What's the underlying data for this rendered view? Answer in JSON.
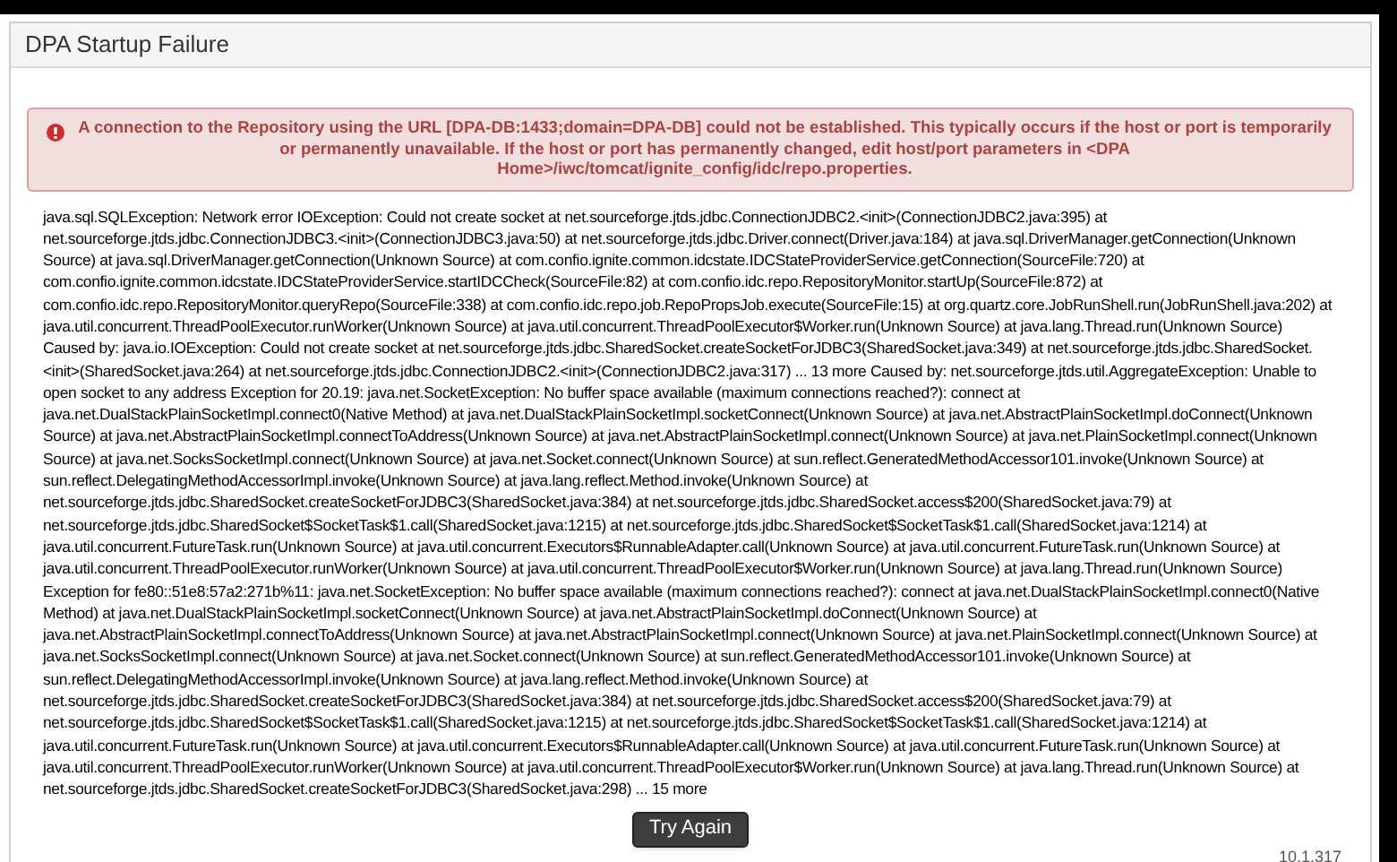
{
  "panel": {
    "title": "DPA Startup Failure"
  },
  "alert": {
    "message": "A connection to the Repository using the URL [DPA-DB:1433;domain=DPA-DB] could not be established. This typically occurs if the host or port is temporarily or permanently unavailable. If the host or port has permanently changed, edit host/port parameters in <DPA Home>/iwc/tomcat/ignite_config/idc/repo.properties."
  },
  "stack_trace": "java.sql.SQLException: Network error IOException: Could not create socket at net.sourceforge.jtds.jdbc.ConnectionJDBC2.<init>(ConnectionJDBC2.java:395) at net.sourceforge.jtds.jdbc.ConnectionJDBC3.<init>(ConnectionJDBC3.java:50) at net.sourceforge.jtds.jdbc.Driver.connect(Driver.java:184) at java.sql.DriverManager.getConnection(Unknown Source) at java.sql.DriverManager.getConnection(Unknown Source) at com.confio.ignite.common.idcstate.IDCStateProviderService.getConnection(SourceFile:720) at com.confio.ignite.common.idcstate.IDCStateProviderService.startIDCCheck(SourceFile:82) at com.confio.idc.repo.RepositoryMonitor.startUp(SourceFile:872) at com.confio.idc.repo.RepositoryMonitor.queryRepo(SourceFile:338) at com.confio.idc.repo.job.RepoPropsJob.execute(SourceFile:15) at org.quartz.core.JobRunShell.run(JobRunShell.java:202) at java.util.concurrent.ThreadPoolExecutor.runWorker(Unknown Source) at java.util.concurrent.ThreadPoolExecutor$Worker.run(Unknown Source) at java.lang.Thread.run(Unknown Source) Caused by: java.io.IOException: Could not create socket at net.sourceforge.jtds.jdbc.SharedSocket.createSocketForJDBC3(SharedSocket.java:349) at net.sourceforge.jtds.jdbc.SharedSocket.<init>(SharedSocket.java:264) at net.sourceforge.jtds.jdbc.ConnectionJDBC2.<init>(ConnectionJDBC2.java:317) ... 13 more Caused by: net.sourceforge.jtds.util.AggregateException: Unable to open socket to any address Exception for 20.19: java.net.SocketException: No buffer space available (maximum connections reached?): connect at java.net.DualStackPlainSocketImpl.connect0(Native Method) at java.net.DualStackPlainSocketImpl.socketConnect(Unknown Source) at java.net.AbstractPlainSocketImpl.doConnect(Unknown Source) at java.net.AbstractPlainSocketImpl.connectToAddress(Unknown Source) at java.net.AbstractPlainSocketImpl.connect(Unknown Source) at java.net.PlainSocketImpl.connect(Unknown Source) at java.net.SocksSocketImpl.connect(Unknown Source) at java.net.Socket.connect(Unknown Source) at sun.reflect.GeneratedMethodAccessor101.invoke(Unknown Source) at sun.reflect.DelegatingMethodAccessorImpl.invoke(Unknown Source) at java.lang.reflect.Method.invoke(Unknown Source) at net.sourceforge.jtds.jdbc.SharedSocket.createSocketForJDBC3(SharedSocket.java:384) at net.sourceforge.jtds.jdbc.SharedSocket.access$200(SharedSocket.java:79) at net.sourceforge.jtds.jdbc.SharedSocket$SocketTask$1.call(SharedSocket.java:1215) at net.sourceforge.jtds.jdbc.SharedSocket$SocketTask$1.call(SharedSocket.java:1214) at java.util.concurrent.FutureTask.run(Unknown Source) at java.util.concurrent.Executors$RunnableAdapter.call(Unknown Source) at java.util.concurrent.FutureTask.run(Unknown Source) at java.util.concurrent.ThreadPoolExecutor.runWorker(Unknown Source) at java.util.concurrent.ThreadPoolExecutor$Worker.run(Unknown Source) at java.lang.Thread.run(Unknown Source) Exception for fe80::51e8:57a2:271b%11: java.net.SocketException: No buffer space available (maximum connections reached?): connect at java.net.DualStackPlainSocketImpl.connect0(Native Method) at java.net.DualStackPlainSocketImpl.socketConnect(Unknown Source) at java.net.AbstractPlainSocketImpl.doConnect(Unknown Source) at java.net.AbstractPlainSocketImpl.connectToAddress(Unknown Source) at java.net.AbstractPlainSocketImpl.connect(Unknown Source) at java.net.PlainSocketImpl.connect(Unknown Source) at java.net.SocksSocketImpl.connect(Unknown Source) at java.net.Socket.connect(Unknown Source) at sun.reflect.GeneratedMethodAccessor101.invoke(Unknown Source) at sun.reflect.DelegatingMethodAccessorImpl.invoke(Unknown Source) at java.lang.reflect.Method.invoke(Unknown Source) at net.sourceforge.jtds.jdbc.SharedSocket.createSocketForJDBC3(SharedSocket.java:384) at net.sourceforge.jtds.jdbc.SharedSocket.access$200(SharedSocket.java:79) at net.sourceforge.jtds.jdbc.SharedSocket$SocketTask$1.call(SharedSocket.java:1215) at net.sourceforge.jtds.jdbc.SharedSocket$SocketTask$1.call(SharedSocket.java:1214) at java.util.concurrent.FutureTask.run(Unknown Source) at java.util.concurrent.Executors$RunnableAdapter.call(Unknown Source) at java.util.concurrent.FutureTask.run(Unknown Source) at java.util.concurrent.ThreadPoolExecutor.runWorker(Unknown Source) at java.util.concurrent.ThreadPoolExecutor$Worker.run(Unknown Source) at java.lang.Thread.run(Unknown Source) at net.sourceforge.jtds.jdbc.SharedSocket.createSocketForJDBC3(SharedSocket.java:298) ... 15 more",
  "button": {
    "label": "Try Again"
  },
  "version": "10.1.317"
}
